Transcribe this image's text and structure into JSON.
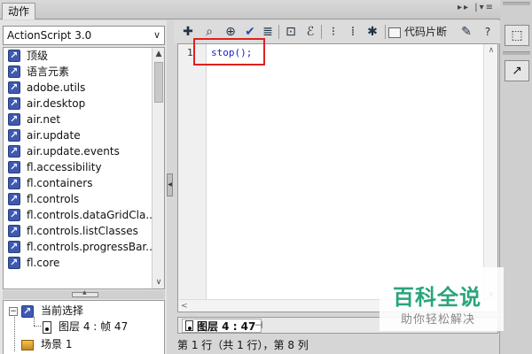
{
  "panel": {
    "title": "动作"
  },
  "language_select": {
    "value": "ActionScript 3.0"
  },
  "toolbox": {
    "items": [
      "顶级",
      "语言元素",
      "adobe.utils",
      "air.desktop",
      "air.net",
      "air.update",
      "air.update.events",
      "fl.accessibility",
      "fl.containers",
      "fl.controls",
      "fl.controls.dataGridCla...",
      "fl.controls.listClasses",
      "fl.controls.progressBar...",
      "fl.core"
    ]
  },
  "script_navigator": {
    "current_selection": "当前选择",
    "layer_frame": "图层 4 : 帧 47",
    "scene": "场景 1"
  },
  "toolbar": {
    "code_snippets": "代码片断"
  },
  "editor": {
    "line_number": "1",
    "code": "stop();",
    "layer_tab": "图层 4 : 47"
  },
  "status": {
    "text": "第 1 行（共 1 行），第 8 列"
  },
  "watermark": {
    "main": "百科全说",
    "sub": "助你轻松解决"
  },
  "colors": {
    "code": "#1a1ad6",
    "highlight": "#e02020",
    "watermark": "#2aa57a",
    "icon_blue": "#3c59b4"
  }
}
